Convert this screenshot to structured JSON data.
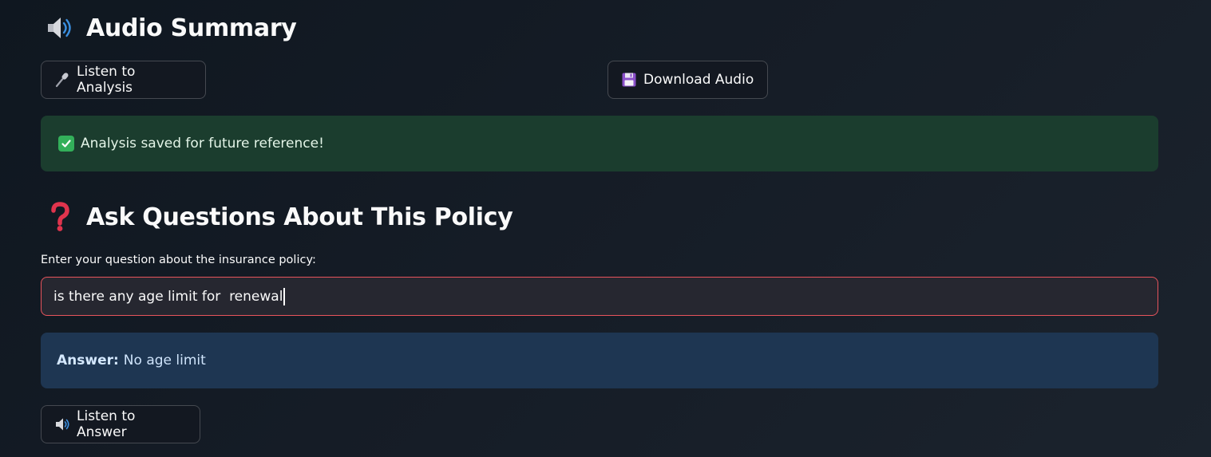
{
  "audio_section": {
    "title": "Audio Summary",
    "icon": "speaker-icon",
    "listen_button": {
      "label": "Listen to Analysis",
      "icon": "microphone-icon"
    },
    "download_button": {
      "label": "Download Audio",
      "icon": "floppy-disk-icon"
    }
  },
  "success_alert": {
    "icon": "check-box-icon",
    "message": "Analysis saved for future reference!",
    "color": "#1b3d2e"
  },
  "qa_section": {
    "title": "Ask Questions About This Policy",
    "icon": "question-mark-icon",
    "input_label": "Enter your question about the insurance policy:",
    "input_value": "is there any age limit for  renewal",
    "answer_label": "Answer:",
    "answer_text": "No age limit",
    "listen_answer_button": {
      "label": "Listen to Answer",
      "icon": "speaker-icon"
    }
  },
  "colors": {
    "input_border": "#e8545c",
    "answer_background": "#1e3652",
    "success_check": "#33b05a"
  }
}
